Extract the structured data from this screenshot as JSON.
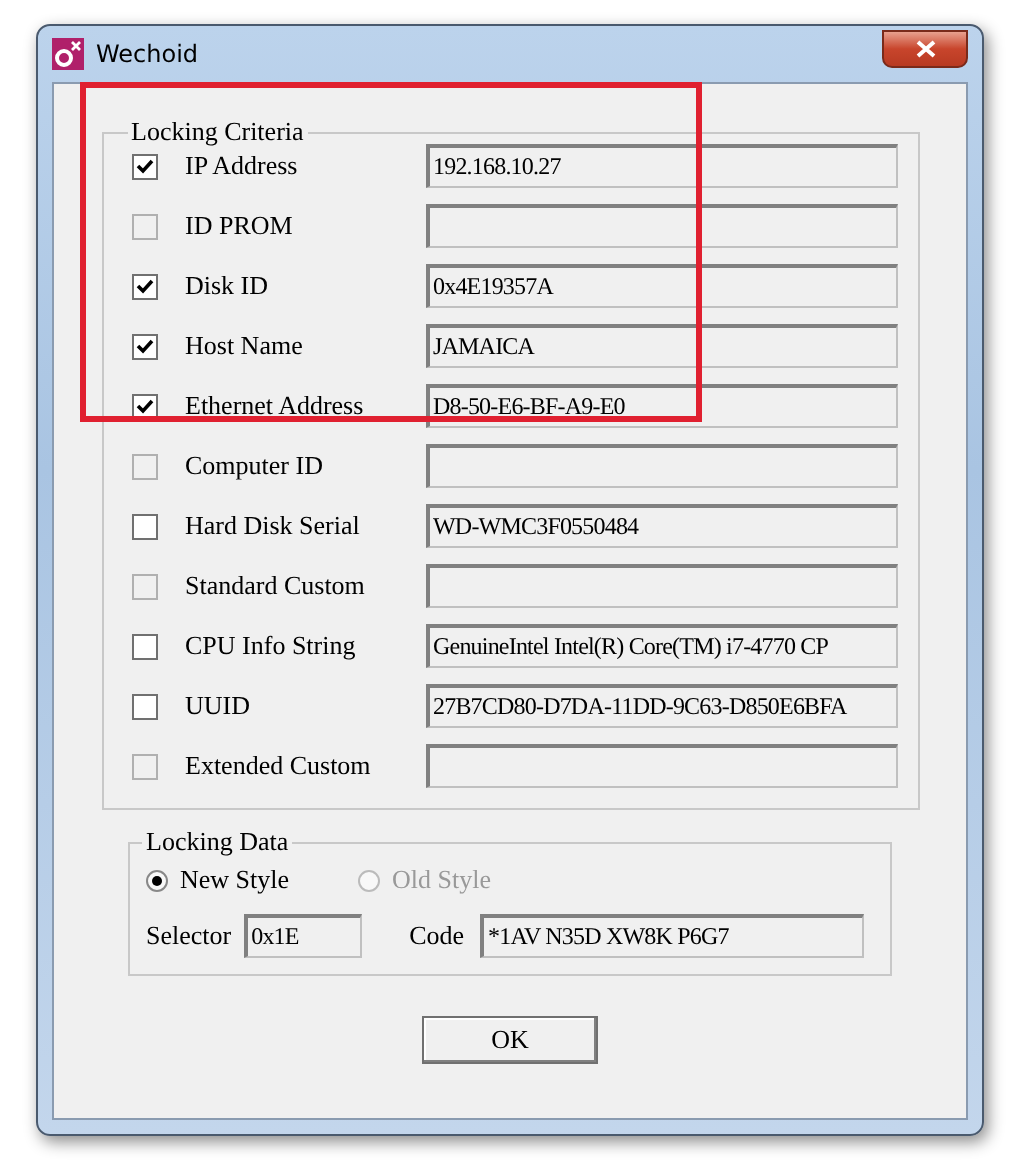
{
  "window": {
    "title": "Wechoid"
  },
  "locking_criteria": {
    "title": "Locking Criteria",
    "items": [
      {
        "label": "IP Address",
        "checked": true,
        "disabled": false,
        "value": "192.168.10.27"
      },
      {
        "label": "ID PROM",
        "checked": false,
        "disabled": true,
        "value": ""
      },
      {
        "label": "Disk ID",
        "checked": true,
        "disabled": false,
        "value": "0x4E19357A"
      },
      {
        "label": "Host Name",
        "checked": true,
        "disabled": false,
        "value": "JAMAICA"
      },
      {
        "label": "Ethernet Address",
        "checked": true,
        "disabled": false,
        "value": "D8-50-E6-BF-A9-E0"
      },
      {
        "label": "Computer ID",
        "checked": false,
        "disabled": true,
        "value": ""
      },
      {
        "label": "Hard Disk Serial",
        "checked": false,
        "disabled": false,
        "value": "WD-WMC3F0550484"
      },
      {
        "label": "Standard Custom",
        "checked": false,
        "disabled": true,
        "value": ""
      },
      {
        "label": "CPU Info String",
        "checked": false,
        "disabled": false,
        "value": "GenuineIntel Intel(R) Core(TM) i7-4770 CP"
      },
      {
        "label": "UUID",
        "checked": false,
        "disabled": false,
        "value": "27B7CD80-D7DA-11DD-9C63-D850E6BFA"
      },
      {
        "label": "Extended Custom",
        "checked": false,
        "disabled": true,
        "value": ""
      }
    ]
  },
  "locking_data": {
    "title": "Locking Data",
    "styles": [
      {
        "label": "New Style",
        "selected": true,
        "disabled": false
      },
      {
        "label": "Old Style",
        "selected": false,
        "disabled": true
      }
    ],
    "selector_label": "Selector",
    "selector": "0x1E",
    "code_label": "Code",
    "code": "*1AV N35D XW8K P6G7"
  },
  "buttons": [
    "OK"
  ]
}
